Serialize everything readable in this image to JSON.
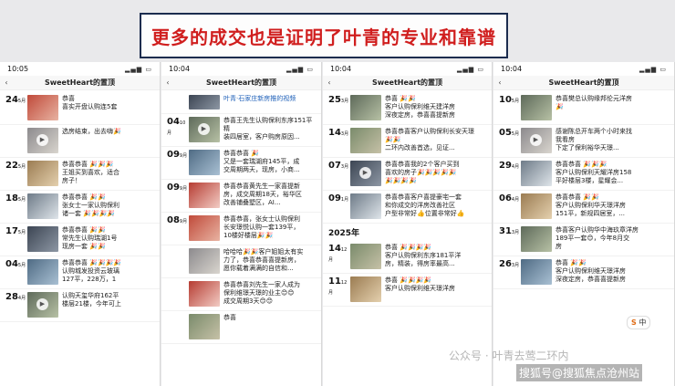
{
  "banner": {
    "text": "更多的成交也是证明了叶青的专业和靠谱"
  },
  "panels": [
    {
      "time": "10:05",
      "title": "SweetHeart的置顶",
      "rows": [
        {
          "date": "24",
          "unit": "5月",
          "text": "恭喜\n喜实开盘认购连5套"
        },
        {
          "date": "",
          "unit": "",
          "text": "选房结束，出去嗨🎉"
        },
        {
          "date": "22",
          "unit": "5月",
          "text": "恭喜恭喜 🎉🎉🎉\n王姐买到喜欢，适合\n房子！"
        },
        {
          "date": "18",
          "unit": "5月",
          "text": "恭喜恭喜 🎉🎉\n张女士一家认购保利\n诸一套 🎉🎉🎉🎉"
        },
        {
          "date": "17",
          "unit": "5月",
          "text": "恭喜恭喜 🎉🎉\n常先生认购瑞湖1号\n现房一套 🎉🎉"
        },
        {
          "date": "04",
          "unit": "5月",
          "text": "恭喜恭喜 🎉🎉🎉🎉\n认购城发投资云玻璃\n127平，228万，1"
        },
        {
          "date": "28",
          "unit": "4月",
          "text": "认购天玺华府162平\n楼层21楼，今年可上"
        }
      ]
    },
    {
      "time": "10:04",
      "title": "SweetHeart的置顶",
      "rows": [
        {
          "date": "",
          "unit": "",
          "text": "叶青·石家庄新房推的视频"
        },
        {
          "date": "04",
          "unit": "10月",
          "text": "恭喜王先生认购保利东序151平精\n装四居室，客户购房原因..."
        },
        {
          "date": "09",
          "unit": "9月",
          "text": "恭喜恭喜 🎉\n又是一套瑞湖府145平，成\n交周期两天，现房，小商..."
        },
        {
          "date": "09",
          "unit": "9月",
          "text": "恭喜恭喜黄先生一家喜提新\n房，成交周期18天，裕华区\n改善铺叠墅区，AI..."
        },
        {
          "date": "08",
          "unit": "9月",
          "text": "恭喜恭喜，张女士认购保利\n长安璟悦认购一套139平，\n10楼好楼层🎉🎉"
        },
        {
          "date": "",
          "unit": "",
          "text": "哈哈哈🎉🎉客户姐姐太有实\n力了，恭喜恭喜喜提新房，\n愿你载着满满的自信和..."
        },
        {
          "date": "",
          "unit": "",
          "text": "恭喜恭喜刘先生一家人成为\n保利维璟天璟的业主😊😊\n成交周期3天😊😊"
        },
        {
          "date": "",
          "unit": "",
          "text": "恭喜"
        }
      ]
    },
    {
      "time": "10:04",
      "title": "SweetHeart的置顶",
      "year_label": "2025年",
      "rows": [
        {
          "date": "25",
          "unit": "3月",
          "text": "恭喜 🎉🎉\n客户认购保利维天建洋房\n深夜定房，恭喜喜提新房"
        },
        {
          "date": "14",
          "unit": "3月",
          "text": "恭喜恭喜客户认购保利长安天璟\n🎉🎉\n二环内改善首选，见证..."
        },
        {
          "date": "07",
          "unit": "3月",
          "text": "恭喜恭喜我的2个客户买到\n喜欢的房子🎉🎉🎉🎉🎉\n🎉🎉🎉🎉"
        },
        {
          "date": "09",
          "unit": "1月",
          "text": "恭喜恭喜客户喜提豪宅一套\n和你成交的洋房改善社区\n户型非常好👍位置非常好👍"
        },
        {
          "date": "14",
          "unit": "12月",
          "text": "恭喜 🎉🎉🎉🎉\n客户认购保利东序181平洋\n房，精装，得房率最高..."
        },
        {
          "date": "11",
          "unit": "12月",
          "text": "恭喜 🎉🎉🎉🎉\n客户认购保利维天璟洋房"
        }
      ]
    },
    {
      "time": "10:04",
      "title": "SweetHeart的置顶",
      "rows": [
        {
          "date": "10",
          "unit": "5月",
          "text": "恭喜樊总认购缘邦伦元洋房\n🎉"
        },
        {
          "date": "05",
          "unit": "5月",
          "text": "感谢陈总开车两个小时来找\n我看房\n下定了保利裕华天璟..."
        },
        {
          "date": "29",
          "unit": "4月",
          "text": "恭喜恭喜 🎉🎉🎉\n客户认购保利天耀洋房158\n平好楼层3楼，星耀会..."
        },
        {
          "date": "06",
          "unit": "4月",
          "text": "恭喜恭喜 🎉🎉\n客户认购保利华天璟洋房\n151平，新规四居室，..."
        },
        {
          "date": "31",
          "unit": "3月",
          "text": "恭喜客户认购华中海玖章洋房\n189平一套😊，今年8月交\n房"
        },
        {
          "date": "26",
          "unit": "3月",
          "text": "恭喜 🎉🎉\n客户认购保利维天璟洋房\n深夜定房，恭喜喜提新房"
        }
      ]
    }
  ],
  "icons": {
    "back": "chevron-left-icon",
    "play": "play-icon"
  },
  "overlay": {
    "watermark_account": "公众号 · 叶青去莺二环内",
    "watermark_sohu": "搜狐号@搜狐焦点沧州站",
    "badge": "中"
  },
  "colors": {
    "banner_text": "#d01e1e",
    "banner_border": "#1b2c4e"
  }
}
